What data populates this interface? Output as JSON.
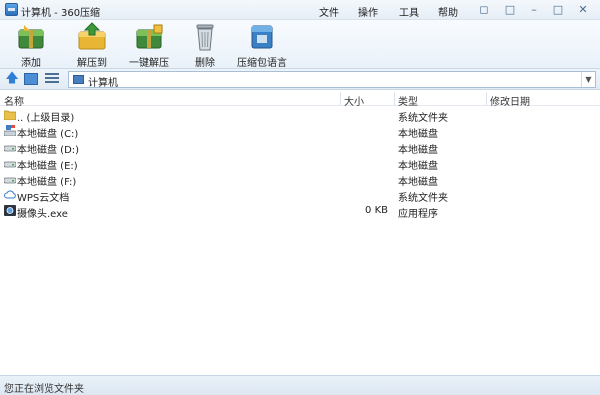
{
  "window": {
    "title": "计算机 - 360压缩"
  },
  "menu": [
    "文件",
    "操作",
    "工具",
    "帮助"
  ],
  "toolbar": [
    {
      "label": "添加",
      "icon": "add-archive-icon"
    },
    {
      "label": "解压到",
      "icon": "extract-to-icon"
    },
    {
      "label": "一键解压",
      "icon": "one-click-extract-icon"
    },
    {
      "label": "删除",
      "icon": "trash-icon"
    },
    {
      "label": "压缩包语言",
      "icon": "archive-language-icon"
    }
  ],
  "address": {
    "path": "计算机"
  },
  "columns": [
    "名称",
    "大小",
    "类型",
    "修改日期"
  ],
  "files": [
    {
      "name": ".. (上级目录)",
      "size": "",
      "type": "系统文件夹",
      "icon": "folder-up-icon"
    },
    {
      "name": "本地磁盘 (C:)",
      "size": "",
      "type": "本地磁盘",
      "icon": "system-drive-icon"
    },
    {
      "name": "本地磁盘 (D:)",
      "size": "",
      "type": "本地磁盘",
      "icon": "drive-icon"
    },
    {
      "name": "本地磁盘 (E:)",
      "size": "",
      "type": "本地磁盘",
      "icon": "drive-icon"
    },
    {
      "name": "本地磁盘 (F:)",
      "size": "",
      "type": "本地磁盘",
      "icon": "drive-icon"
    },
    {
      "name": "WPS云文档",
      "size": "",
      "type": "系统文件夹",
      "icon": "cloud-icon"
    },
    {
      "name": "摄像头.exe",
      "size": "0 KB",
      "type": "应用程序",
      "icon": "camera-app-icon"
    }
  ],
  "status": {
    "text": "您正在浏览文件夹"
  }
}
